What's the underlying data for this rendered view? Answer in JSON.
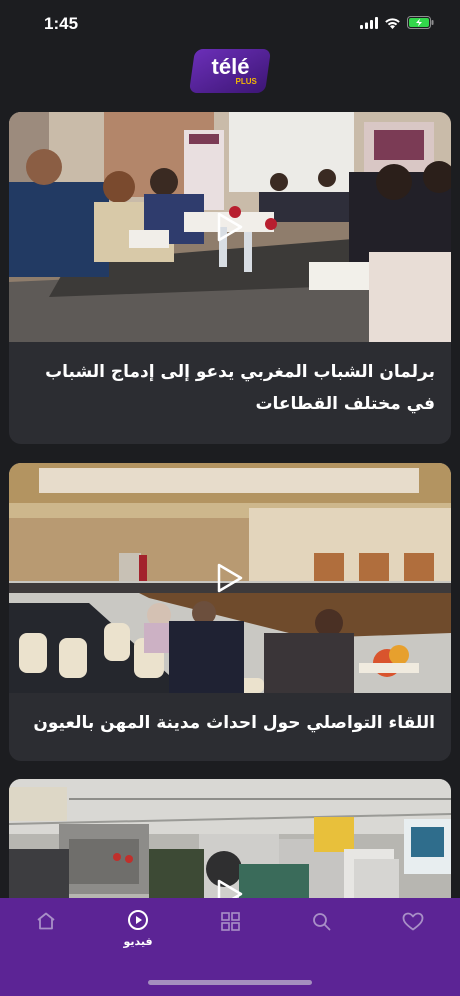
{
  "status": {
    "time": "1:45",
    "signal_icon": "cellular-signal-icon",
    "wifi_icon": "wifi-icon",
    "battery_icon": "battery-charging-icon",
    "battery_color": "#32d74b"
  },
  "brand": {
    "logo_main": "télé",
    "logo_sub": "PLUS",
    "accent": "#5c2495",
    "logo_yellow": "#f2b705"
  },
  "videos": [
    {
      "title": "برلمان الشباب المغربي يدعو إلى إدماج الشباب في مختلف القطاعات",
      "play_icon": "play-icon"
    },
    {
      "title": "اللقاء التواصلي حول احداث مدينة المهن بالعيون",
      "play_icon": "play-icon"
    },
    {
      "title": "",
      "play_icon": "play-icon"
    }
  ],
  "tabs": [
    {
      "icon": "home-icon",
      "label": ""
    },
    {
      "icon": "video-play-icon",
      "label": "فيديو",
      "active": true
    },
    {
      "icon": "categories-grid-icon",
      "label": ""
    },
    {
      "icon": "search-icon",
      "label": ""
    },
    {
      "icon": "heart-icon",
      "label": ""
    }
  ]
}
